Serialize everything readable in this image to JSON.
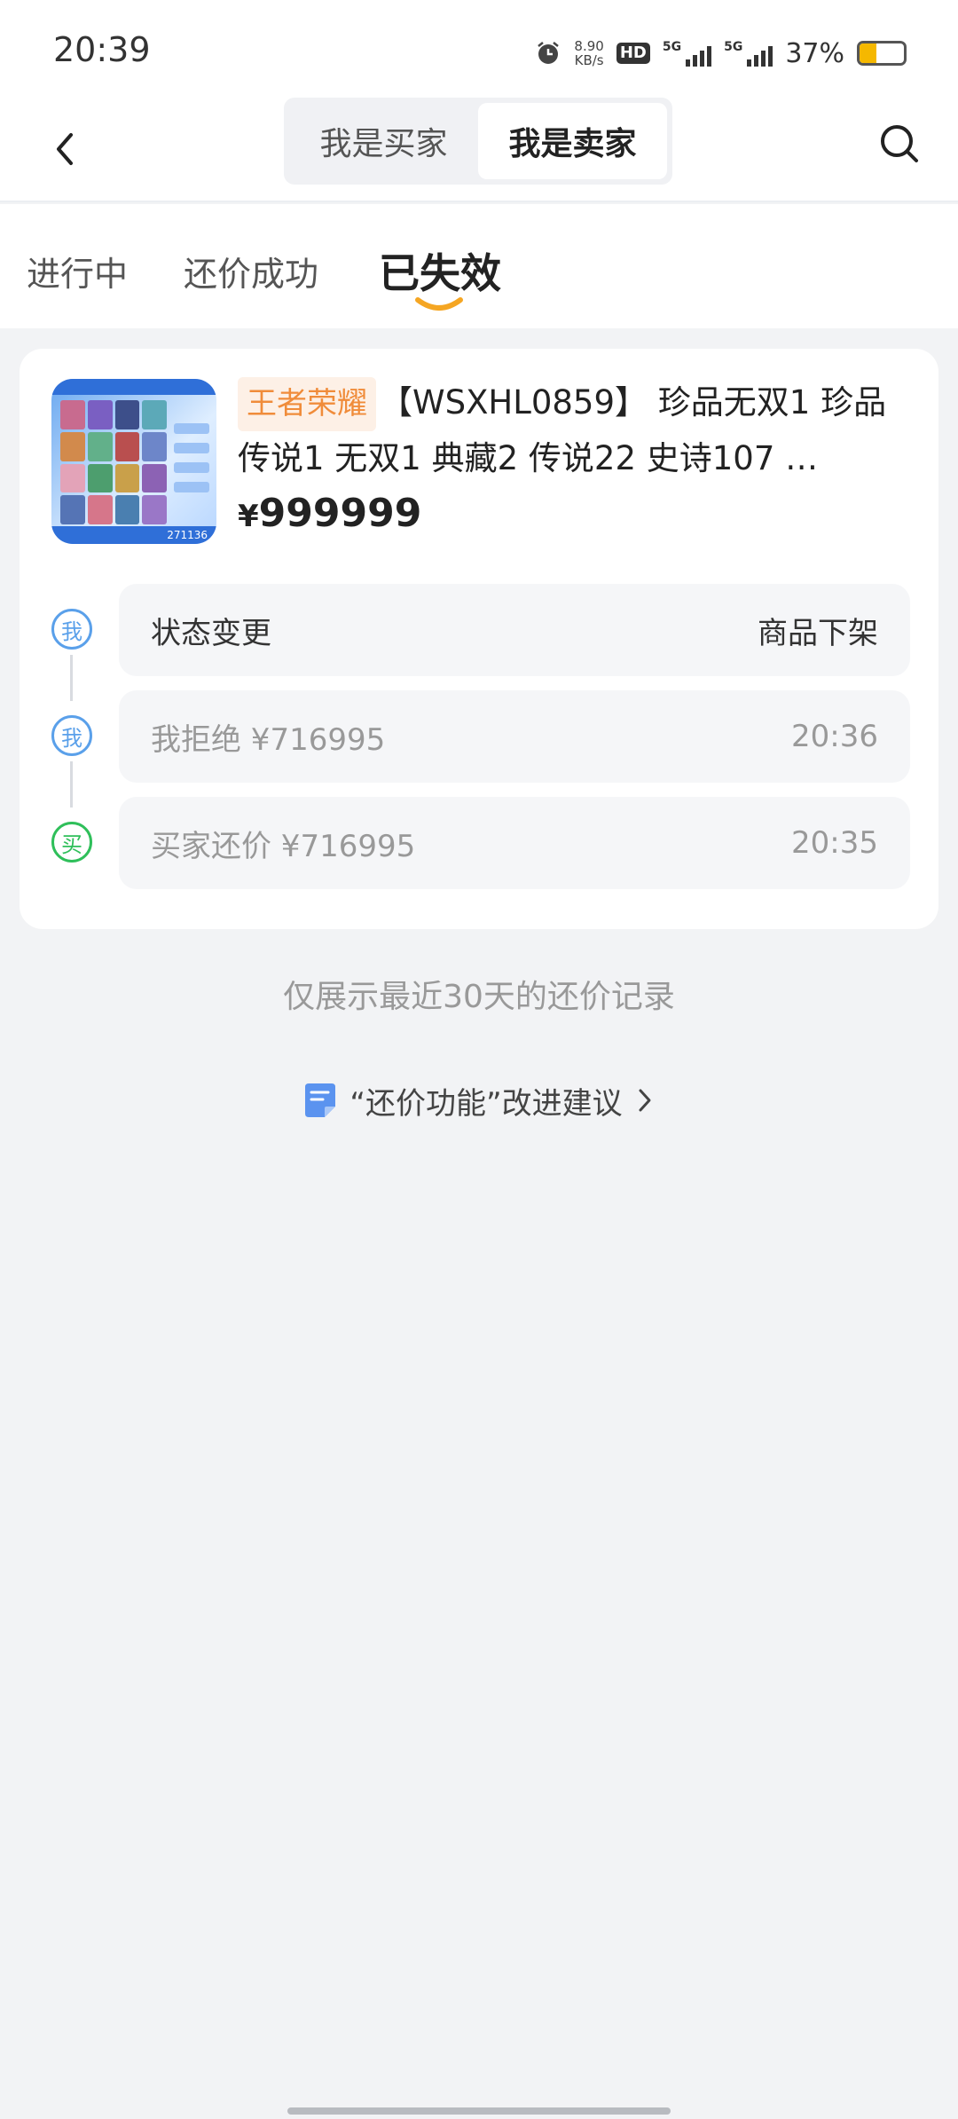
{
  "status_bar": {
    "time": "20:39",
    "net_speed_value": "8.90",
    "net_speed_unit": "KB/s",
    "hd_label": "HD",
    "sim1_label": "5G",
    "sim2_label": "5G",
    "battery_pct": "37%",
    "battery_level": 0.37,
    "battery_color": "#f5b800"
  },
  "nav": {
    "segments": [
      {
        "label": "我是买家",
        "active": false
      },
      {
        "label": "我是卖家",
        "active": true
      }
    ],
    "back_icon": "chevron-left-icon",
    "search_icon": "search-icon"
  },
  "tabs": [
    {
      "label": "进行中",
      "active": false
    },
    {
      "label": "还价成功",
      "active": false
    },
    {
      "label": "已失效",
      "active": true
    }
  ],
  "accent_color": "#f08c3a",
  "item": {
    "game_tag": "王者荣耀",
    "title": "【WSXHL0859】 珍品无双1 珍品传说1 无双1 典藏2 传说22 史诗107 …",
    "price_currency": "¥",
    "price_value": "999999",
    "thumb_footer": "271136"
  },
  "timeline": [
    {
      "actor": "我",
      "role": "me",
      "left": "状态变更",
      "right": "商品下架",
      "emphasis": true
    },
    {
      "actor": "我",
      "role": "me",
      "left": "我拒绝 ¥716995",
      "right": "20:36",
      "emphasis": false
    },
    {
      "actor": "买",
      "role": "buyer",
      "left": "买家还价 ¥716995",
      "right": "20:35",
      "emphasis": false
    }
  ],
  "footer": {
    "note": "仅展示最近30天的还价记录",
    "feedback_label": "“还价功能”改进建议"
  }
}
